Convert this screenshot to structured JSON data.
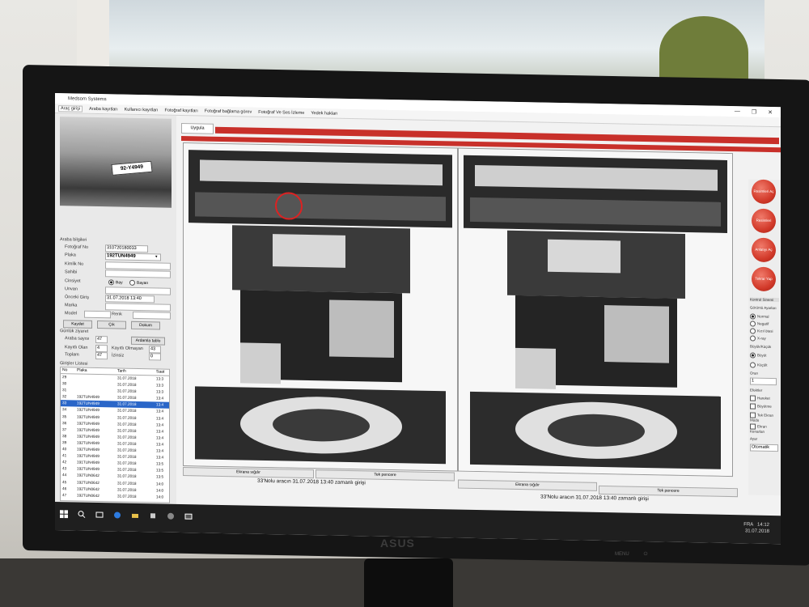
{
  "app": {
    "title": "Medsom Systems",
    "window_controls": [
      "—",
      "❐",
      "✕"
    ]
  },
  "menu": {
    "items": [
      "Araç girişi",
      "Araba kayıtları",
      "Kullanıcı kayıtları",
      "Fotoğraf kayıtları",
      "Fotoğraf bağlama görev",
      "Fotoğraf Ve Ses İzleme",
      "Yedek hakları"
    ],
    "active_index": 0
  },
  "left": {
    "plate_on_photo": "92-Y4949",
    "info_title": "Araba bilgileri",
    "fields": [
      {
        "label": "Fotoğraf No",
        "value": "310720180033"
      },
      {
        "label": "Plaka",
        "value": "192TUN4949"
      },
      {
        "label": "Kimlik No",
        "value": ""
      },
      {
        "label": "Sahibi",
        "value": ""
      },
      {
        "label": "Cinsiyet",
        "value": ""
      },
      {
        "label": "Unvan",
        "value": ""
      },
      {
        "label": "Önceki Giriş",
        "value": "31.07.2018 13:40"
      },
      {
        "label": "Marka",
        "value": ""
      },
      {
        "label": "Model",
        "value": ""
      },
      {
        "label": "Renk",
        "value": ""
      }
    ],
    "gender_options": [
      "Bay",
      "Bayan"
    ],
    "gender_selected": "Bay",
    "buttons": [
      "Kaydet",
      "Çık",
      "Dokum"
    ],
    "stats_title": "Günlük ziyaret",
    "stats": [
      {
        "label": "Araba sayısı",
        "value": "47"
      },
      {
        "label": "Kayıtlı Olan",
        "value": "4"
      },
      {
        "label": "Kayıtlı Olmayan",
        "value": "43"
      },
      {
        "label": "Toplam",
        "value": "47"
      },
      {
        "label": "İzinsiz",
        "value": "0"
      }
    ],
    "refresh_button": "Ardamla tablo",
    "list_title": "Girişler Listesi",
    "list_headers": [
      "No",
      "Plaka",
      "Tarih",
      "Saat"
    ],
    "list_rows": [
      {
        "no": "29",
        "plate": "",
        "date": "31.07.2018",
        "time": "13:3"
      },
      {
        "no": "30",
        "plate": "",
        "date": "31.07.2018",
        "time": "13:3"
      },
      {
        "no": "31",
        "plate": "",
        "date": "31.07.2018",
        "time": "13:3"
      },
      {
        "no": "32",
        "plate": "192TUN4949",
        "date": "31.07.2018",
        "time": "13:4"
      },
      {
        "no": "33",
        "plate": "192TUN4949",
        "date": "31.07.2018",
        "time": "13:4"
      },
      {
        "no": "34",
        "plate": "192TUN4949",
        "date": "31.07.2018",
        "time": "13:4"
      },
      {
        "no": "35",
        "plate": "192TUN4949",
        "date": "31.07.2018",
        "time": "13:4"
      },
      {
        "no": "36",
        "plate": "192TUN4949",
        "date": "31.07.2018",
        "time": "13:4"
      },
      {
        "no": "37",
        "plate": "192TUN4949",
        "date": "31.07.2018",
        "time": "13:4"
      },
      {
        "no": "38",
        "plate": "192TUN4949",
        "date": "31.07.2018",
        "time": "13:4"
      },
      {
        "no": "39",
        "plate": "192TUN4949",
        "date": "31.07.2018",
        "time": "13:4"
      },
      {
        "no": "40",
        "plate": "192TUN4949",
        "date": "31.07.2018",
        "time": "13:4"
      },
      {
        "no": "41",
        "plate": "192TUN4949",
        "date": "31.07.2018",
        "time": "13:4"
      },
      {
        "no": "42",
        "plate": "191TUN4949",
        "date": "31.07.2018",
        "time": "13:5"
      },
      {
        "no": "43",
        "plate": "192TUN4949",
        "date": "31.07.2018",
        "time": "13:5"
      },
      {
        "no": "44",
        "plate": "192TUN0642",
        "date": "31.07.2018",
        "time": "13:5"
      },
      {
        "no": "45",
        "plate": "192TUN0642",
        "date": "31.07.2018",
        "time": "14:0"
      },
      {
        "no": "46",
        "plate": "192TUN0642",
        "date": "31.07.2018",
        "time": "14:0"
      },
      {
        "no": "47",
        "plate": "192TUN0642",
        "date": "31.07.2018",
        "time": "14:0"
      }
    ],
    "selected_row": 4
  },
  "main": {
    "tab": "Uygula",
    "panel_buttons_left": [
      "Ekrana sığdır",
      "Tek pencere"
    ],
    "panel_buttons_right": [
      "Ekrana sığdır",
      "Tek pencere"
    ],
    "caption": "33'Nolu aracın 31.07.2018 13:40 zamanlı girişi"
  },
  "right": {
    "round_buttons": [
      "Resimleri Aç",
      "Resimleri Kaydet",
      "Anlatıyı Aç",
      "Tekrar Yap"
    ],
    "control_header": "Kontrol Sinemi",
    "view_title": "Görüntü Ayarları",
    "view_options": [
      "Normal",
      "Negatif",
      "Kızıl ötesi",
      "X-ray"
    ],
    "view_selected": "Normal",
    "zoom_title": "Büyük/Küçük",
    "zoom_options": [
      "Büyüt",
      "Küçült"
    ],
    "zoom_selected": "Büyüt",
    "ratio_label": "Oran",
    "ratio_value": "1",
    "effects_title": "Efektler",
    "effects": [
      "Hareket",
      "Büyütme",
      "Tek Ekran Modu",
      "Ekran Kenarları"
    ],
    "mode_label": "Ayar",
    "mode_value": "Otomatik"
  },
  "taskbar": {
    "language": "FRA",
    "time": "14:12",
    "date": "31.07.2018"
  },
  "hardware": {
    "brand": "ASUS",
    "buttons": [
      "MENU"
    ]
  },
  "colors": {
    "accent_red": "#c8302a",
    "selection_blue": "#2a66c8"
  }
}
